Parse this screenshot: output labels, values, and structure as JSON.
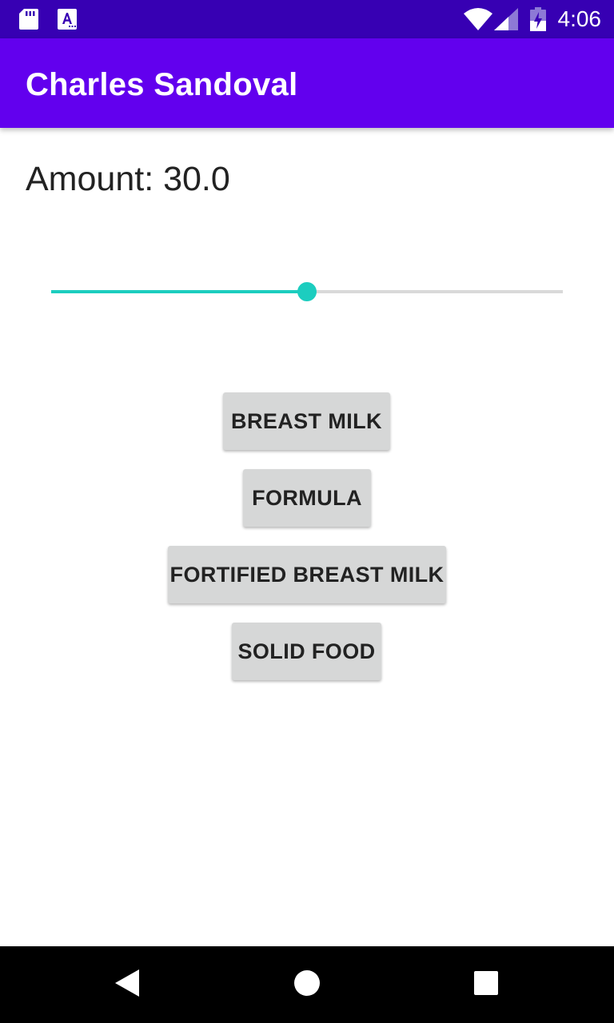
{
  "status_bar": {
    "time": "4:06",
    "icons": [
      "sd-card-icon",
      "font-a-icon",
      "wifi-icon",
      "signal-icon",
      "battery-charging-icon"
    ],
    "background_color": "#3700b3"
  },
  "app_bar": {
    "title": "Charles Sandoval",
    "background_color": "#6200ee"
  },
  "amount": {
    "label": "Amount: 30.0"
  },
  "slider": {
    "fraction": 0.5,
    "accent_color": "#1ccdbf"
  },
  "buttons": {
    "breast_milk": "BREAST MILK",
    "formula": "FORMULA",
    "fortified_breast_milk": "FORTIFIED BREAST MILK",
    "solid_food": "SOLID FOOD"
  },
  "nav_bar": {
    "icons": [
      "back-icon",
      "home-icon",
      "recents-icon"
    ]
  }
}
